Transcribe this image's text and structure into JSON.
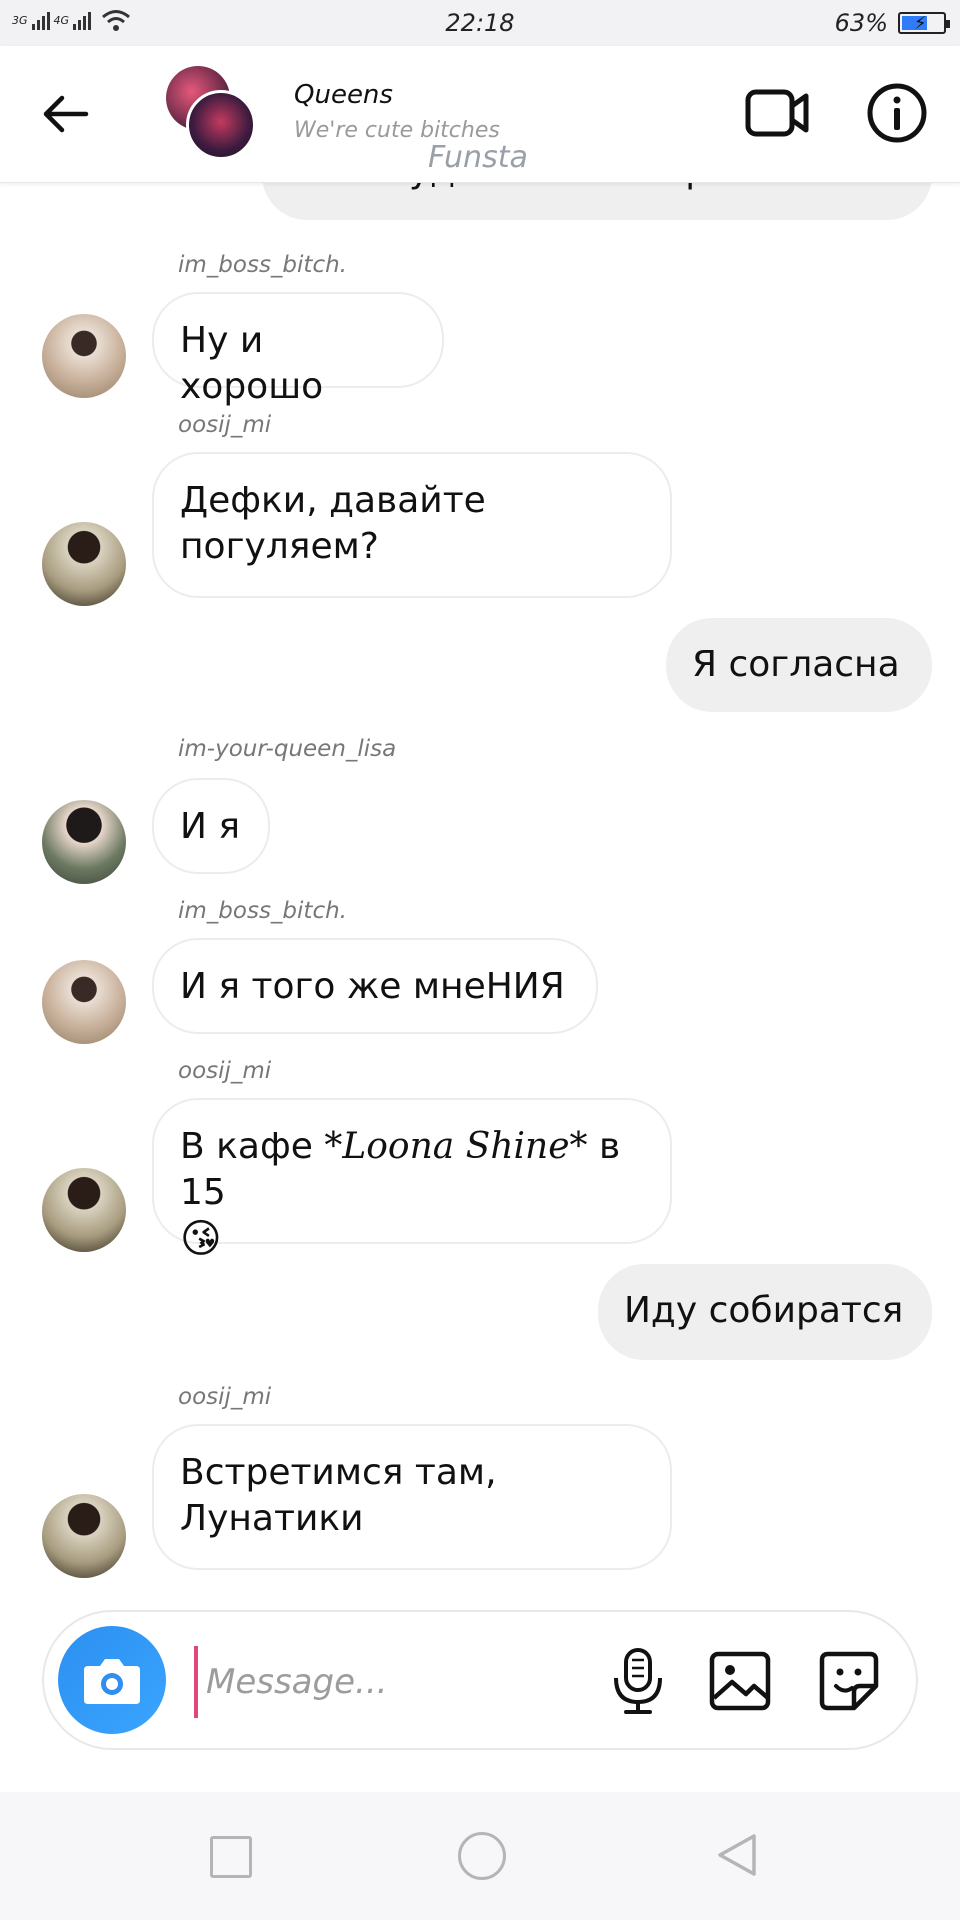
{
  "status_bar": {
    "network_1": "3G",
    "network_2": "4G",
    "time": "22:18",
    "battery_text": "63%",
    "battery_level": 0.63
  },
  "header": {
    "title": "Queens",
    "subtitle": "We're cute bitches",
    "back_icon": "arrow-left-icon",
    "video_icon": "video-camera-icon",
    "info_icon": "info-icon"
  },
  "watermark": "Funsta",
  "messages": [
    {
      "text": "И Кай удалил иестаграм",
      "direction": "out"
    },
    {
      "sender": "im_boss_bitch.",
      "text": "Ну и хорошо",
      "direction": "in"
    },
    {
      "sender": "oosij_mi",
      "text": "Дефки, давайте погуляем?",
      "direction": "in"
    },
    {
      "text": "Я согласна",
      "direction": "out"
    },
    {
      "sender": "im-your-queen_lisa",
      "text": "И я",
      "direction": "in"
    },
    {
      "sender": "im_boss_bitch.",
      "text": "И я того же мнеНИЯ",
      "direction": "in"
    },
    {
      "sender": "oosij_mi",
      "text_before": "В кафе ",
      "text_italic": "*Loona Shine*",
      "text_after": " в 15",
      "emoji": "😘",
      "direction": "in"
    },
    {
      "text": "Иду собиратся",
      "direction": "out"
    },
    {
      "sender": "oosij_mi",
      "text": "Встретимся там, Лунатики",
      "direction": "in"
    }
  ],
  "composer": {
    "placeholder": "Message...",
    "value": "",
    "camera_icon": "camera-icon",
    "mic_icon": "microphone-icon",
    "gallery_icon": "image-icon",
    "sticker_icon": "sticker-icon"
  },
  "colors": {
    "accent": "#2f8ff0",
    "incoming_bubble": "#ffffff",
    "outgoing_bubble": "#efefef",
    "cursor": "#e0457b"
  }
}
